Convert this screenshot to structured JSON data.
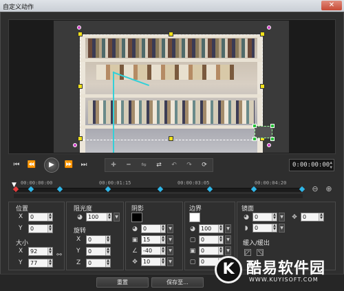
{
  "window": {
    "title": "自定义动作",
    "close_icon": "close-icon"
  },
  "transport": {
    "buttons": [
      "go-to-start-icon",
      "prev-frame-icon",
      "play-icon",
      "next-frame-icon",
      "go-to-end-icon"
    ],
    "tools": [
      "add-keyframe-icon",
      "remove-keyframe-icon",
      "reverse-icon",
      "swap-icon",
      "move-left-icon",
      "move-right-icon",
      "reset-icon"
    ],
    "timecode": "0:00:00:00"
  },
  "timeline": {
    "labels": [
      "00:00:00:00",
      "00:00:01:15",
      "00:00:03:05",
      "00:00:04:20"
    ],
    "zoom_out_icon": "zoom-out-icon",
    "zoom_in_icon": "zoom-in-icon"
  },
  "position": {
    "label": "位置",
    "x_label": "X",
    "y_label": "Y",
    "x": "0",
    "y": "0"
  },
  "size": {
    "label": "大小",
    "x_label": "X",
    "y_label": "Y",
    "x": "92",
    "y": "77"
  },
  "opacity": {
    "label": "阻光度",
    "value": "100"
  },
  "rotation": {
    "label": "旋转",
    "x_label": "X",
    "y_label": "Y",
    "z_label": "Z",
    "x": "0",
    "y": "0",
    "z": "0"
  },
  "shadow": {
    "label": "阴影",
    "color": "#000000",
    "v1": "0",
    "v2": "15",
    "v3": "-40",
    "v4": "10"
  },
  "border": {
    "label": "边界",
    "color": "#ffffff",
    "v1": "100",
    "v2": "0",
    "v3": "0",
    "v4": "0"
  },
  "mirror": {
    "label": "镜面",
    "v1": "0",
    "v2": "0",
    "v3": "0"
  },
  "fade": {
    "label": "缓入/缓出"
  },
  "buttons": {
    "reset": "重置",
    "save_to": "保存至..."
  },
  "watermark": {
    "title": "酷易软件园",
    "url": "WWW.KUYISOFT.COM",
    "logo_letter": "K"
  }
}
